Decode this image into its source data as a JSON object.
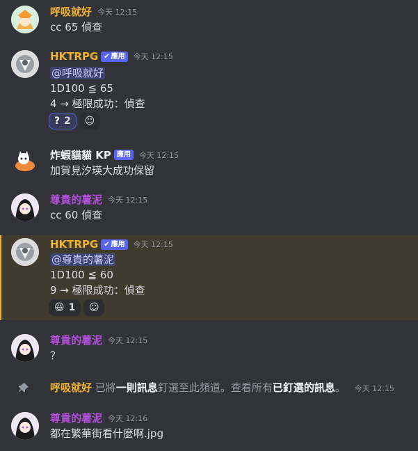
{
  "messages": [
    {
      "user": "呼吸就好",
      "time": "今天 12:15",
      "text": "cc 65 偵查",
      "color": "#f0b232"
    },
    {
      "user": "HKTRPG",
      "tag": "應用",
      "time": "今天 12:15",
      "mention": "@呼吸就好",
      "lines": [
        "1D100 ≦ 65",
        "4 → 極限成功：偵查"
      ],
      "reaction": {
        "emoji": "?",
        "count": "2"
      }
    },
    {
      "user": "炸蝦貓貓 KP",
      "tag": "應用",
      "time": "今天 12:15",
      "text": "加賀見汐瑛大成功保留"
    },
    {
      "user": "尊貴的薯泥",
      "time": "今天 12:15",
      "text": "cc 60 偵查",
      "color": "#b44fdb"
    },
    {
      "user": "HKTRPG",
      "tag": "應用",
      "time": "今天 12:15",
      "mention": "@尊貴的薯泥",
      "lines": [
        "1D100 ≦ 60",
        "9 → 極限成功：偵查"
      ],
      "reaction": {
        "emoji": "😆",
        "count": "1"
      }
    },
    {
      "user": "尊貴的薯泥",
      "time": "今天 12:15",
      "text": "？"
    },
    {
      "user": "尊貴的薯泥",
      "time": "今天 12:16",
      "text": "都在繁華街看什麼啊.jpg"
    }
  ],
  "pin": {
    "user": "呼吸就好",
    "t1": "已將",
    "t2": "一則訊息",
    "t3": "釘選至此頻道。查看所有",
    "t4": "已釘選的訊息",
    "t5": "。",
    "time": "今天 12:15"
  }
}
